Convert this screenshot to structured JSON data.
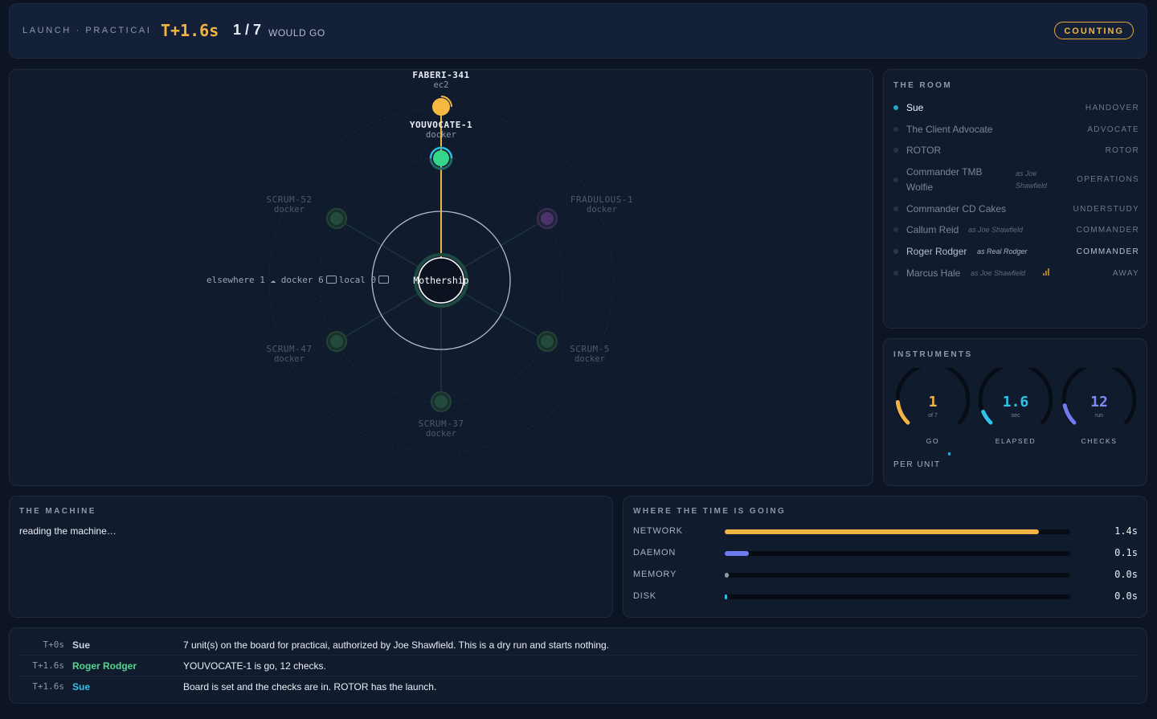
{
  "header": {
    "brand": "LAUNCH · PRACTICAI",
    "clock": "T+1.6s",
    "go_count": "1 / 7",
    "go_suffix": "WOULD GO",
    "status": "COUNTING"
  },
  "map": {
    "center_label": "Mothership",
    "counts": {
      "elsewhere": "elsewhere 1",
      "docker": "docker 6",
      "local": "local 0"
    },
    "nodes": [
      {
        "name": "FABERI-341",
        "type": "ec2",
        "state": "ready",
        "color": "#f5b942"
      },
      {
        "name": "YOUVOCATE-1",
        "type": "docker",
        "state": "go",
        "color": "#35d68a"
      },
      {
        "name": "SCRUM-52",
        "type": "docker",
        "state": "idle",
        "color": "#2b7a5a"
      },
      {
        "name": "FRADULOUS-1",
        "type": "docker",
        "state": "idle",
        "color": "#6a3f8a"
      },
      {
        "name": "SCRUM-47",
        "type": "docker",
        "state": "idle",
        "color": "#2b7a5a"
      },
      {
        "name": "SCRUM-5",
        "type": "docker",
        "state": "idle",
        "color": "#2b7a5a"
      },
      {
        "name": "SCRUM-37",
        "type": "docker",
        "state": "idle",
        "color": "#2b7a5a"
      }
    ]
  },
  "room": {
    "title": "THE ROOM",
    "people": [
      {
        "name": "Sue",
        "as": "",
        "role": "HANDOVER"
      },
      {
        "name": "The Client Advocate",
        "as": "",
        "role": "ADVOCATE"
      },
      {
        "name": "ROTOR",
        "as": "",
        "role": "ROTOR"
      },
      {
        "name": "Commander TMB",
        "name2": "Wolfie",
        "as": "as Joe",
        "as2": "Shawfield",
        "role": "OPERATIONS"
      },
      {
        "name": "Commander CD Cakes",
        "as": "",
        "role": "UNDERSTUDY"
      },
      {
        "name": "Callum Reid",
        "as": "as Joe Shawfield",
        "role": "COMMANDER"
      },
      {
        "name": "Roger Rodger",
        "as": "as Real Rodger",
        "role": "COMMANDER"
      },
      {
        "name": "Marcus Hale",
        "as": "as Joe Shawfield",
        "role": "AWAY"
      }
    ]
  },
  "instruments": {
    "title": "INSTRUMENTS",
    "gauges": [
      {
        "value": "1",
        "sub": "of 7",
        "label": "GO",
        "fraction": 0.14,
        "color": "#f0b445"
      },
      {
        "value": "1.6",
        "sub": "sec",
        "label": "ELAPSED",
        "fraction": 0.08,
        "color": "#2ec4e8"
      },
      {
        "value": "12",
        "sub": "run",
        "label": "CHECKS",
        "fraction": 0.12,
        "color": "#6f7cf0"
      }
    ],
    "per_unit": "PER UNIT"
  },
  "machine": {
    "title": "THE MACHINE",
    "text": "reading the machine…"
  },
  "time": {
    "title": "WHERE THE TIME IS GOING",
    "rows": [
      {
        "label": "NETWORK",
        "value": "1.4s",
        "fraction": 0.91,
        "color": "#f0b445"
      },
      {
        "label": "DAEMON",
        "value": "0.1s",
        "fraction": 0.07,
        "color": "#6f7cf0"
      },
      {
        "label": "MEMORY",
        "value": "0.0s",
        "fraction": 0.012,
        "color": "#8d98ab"
      },
      {
        "label": "DISK",
        "value": "0.0s",
        "fraction": 0.004,
        "color": "#2ec4e8"
      }
    ]
  },
  "log": [
    {
      "t": "T+0s",
      "who": "Sue",
      "who_color": "#c9d2e0",
      "msg": "7 unit(s) on the board for practicai, authorized by Joe Shawfield. This is a dry run and starts nothing."
    },
    {
      "t": "T+1.6s",
      "who": "Roger Rodger",
      "who_color": "#4fd88f",
      "msg": "YOUVOCATE-1 is go, 12 checks."
    },
    {
      "t": "T+1.6s",
      "who": "Sue",
      "who_color": "#2ec4e8",
      "msg": "Board is set and the checks are in. ROTOR has the launch."
    }
  ]
}
